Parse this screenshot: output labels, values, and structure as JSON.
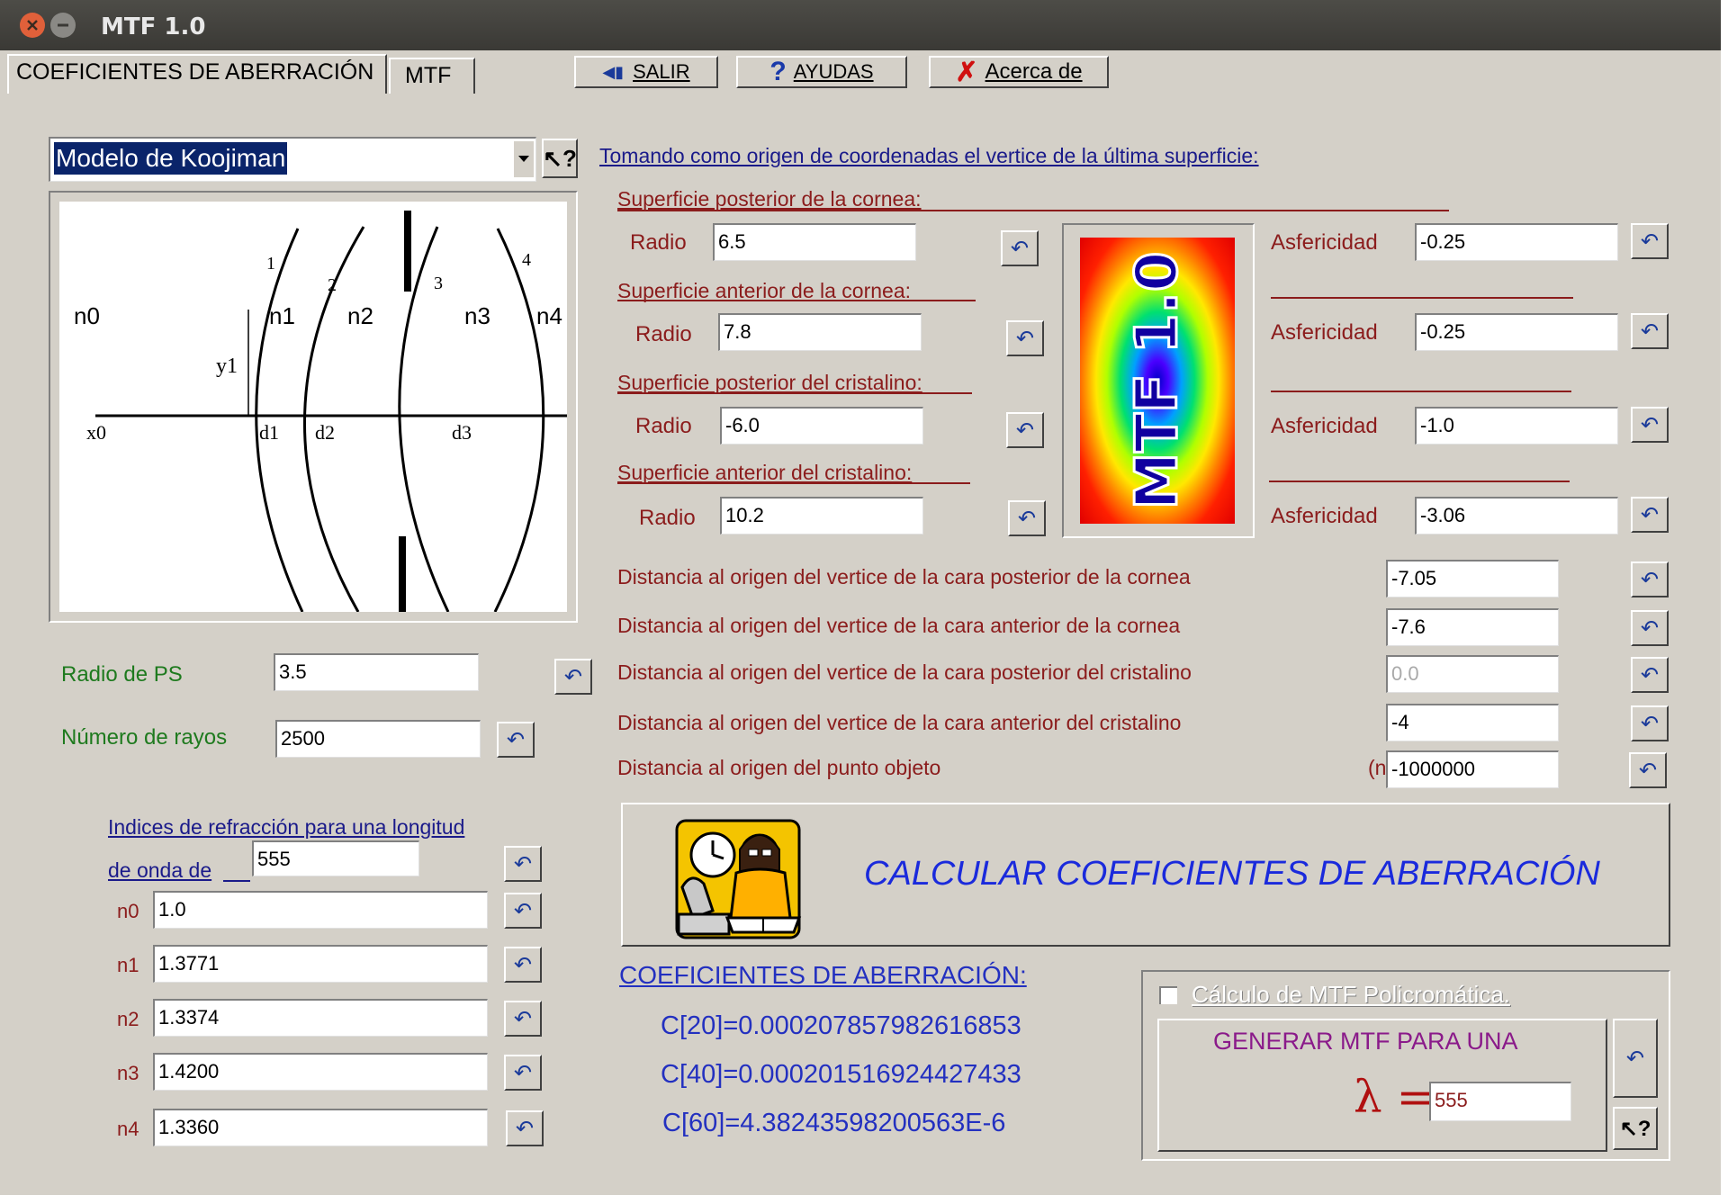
{
  "window": {
    "title": "MTF 1.0"
  },
  "tabs": [
    {
      "label": "COEFICIENTES DE ABERRACIÓN"
    },
    {
      "label": "MTF"
    }
  ],
  "toolbar": {
    "salir": "SALIR",
    "ayudas": "AYUDAS",
    "acerca": "Acerca de"
  },
  "model_select": {
    "value": "Modelo de Koojiman"
  },
  "diagram": {
    "labels": {
      "n0": "n0",
      "n1": "n1",
      "n2": "n2",
      "n3": "n3",
      "n4": "n4",
      "y1": "y1",
      "x0": "x0",
      "d1": "d1",
      "d2": "d2",
      "d3": "d3",
      "s1": "1",
      "s2": "2",
      "s3": "3",
      "s4": "4"
    }
  },
  "origin_title": "Tomando como origen de coordenadas el vertice de la última superficie:",
  "surfaces": [
    {
      "heading": "Superficie posterior de la cornea:",
      "radio_label": "Radio",
      "radio": "6.5",
      "asf_label": "Asfericidad",
      "asf": "-0.25"
    },
    {
      "heading": "Superficie anterior de la cornea:",
      "radio_label": "Radio",
      "radio": "7.8",
      "asf_label": "Asfericidad",
      "asf": "-0.25"
    },
    {
      "heading": "Superficie posterior del cristalino:",
      "radio_label": "Radio",
      "radio": "-6.0",
      "asf_label": "Asfericidad",
      "asf": "-1.0"
    },
    {
      "heading": "Superficie anterior del cristalino:",
      "radio_label": "Radio",
      "radio": "10.2",
      "asf_label": "Asfericidad",
      "asf": "-3.06"
    }
  ],
  "logo": {
    "text": "MTF 1.0"
  },
  "distances": [
    {
      "label": "Distancia al origen del vertice de la cara posterior de la cornea",
      "value": "-7.05"
    },
    {
      "label": "Distancia al origen del vertice de la cara anterior de la cornea",
      "value": "-7.6"
    },
    {
      "label": "Distancia al origen del vertice de la cara posterior del  cristalino",
      "value": "0.0"
    },
    {
      "label": "Distancia al origen del vertice de la cara anterior del  cristalino",
      "value": "-4"
    },
    {
      "label": "Distancia al origen del punto objeto",
      "value": "-1000000",
      "prefix": "(n"
    }
  ],
  "pupil": {
    "label": "Radio de PS",
    "value": "3.5"
  },
  "rays": {
    "label": "Número de rayos",
    "value": "2500"
  },
  "refraction": {
    "title_line1": "Indices de refracción para una longitud",
    "title_line2": "de onda de",
    "wavelength": "555",
    "indices": [
      {
        "label": "n0",
        "value": "1.0"
      },
      {
        "label": "n1",
        "value": "1.3771"
      },
      {
        "label": "n2",
        "value": "1.3374"
      },
      {
        "label": "n3",
        "value": "1.4200"
      },
      {
        "label": "n4",
        "value": "1.3360"
      }
    ]
  },
  "calculate_button": {
    "label": "CALCULAR COEFICIENTES DE ABERRACIÓN"
  },
  "results": {
    "title": "COEFICIENTES DE ABERRACIÓN:",
    "c20": "C[20]=0.000207857982616853",
    "c40": "C[40]=0.000201516924427433",
    "c60": "C[60]=4.38243598200563E-6"
  },
  "mtf_panel": {
    "checkbox_label": "Cálculo de MTF Policromática.",
    "generate_label": "GENERAR MTF PARA UNA",
    "lambda_symbol": "λ =",
    "lambda_value": "555"
  },
  "colors": {
    "face": "#d4d0c8",
    "dark_red": "#8b1c1c",
    "green": "#1e7a1e",
    "blue_text": "#2330c0",
    "title_blue": "#1a1a9a"
  }
}
